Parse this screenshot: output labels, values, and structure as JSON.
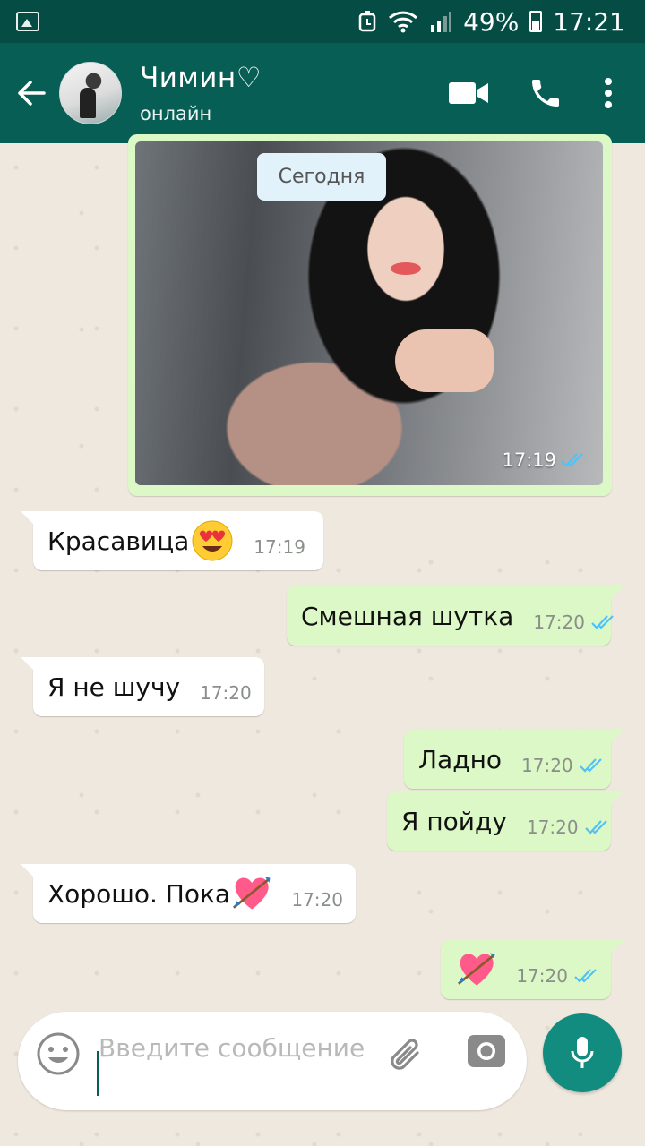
{
  "status_bar": {
    "battery": "49%",
    "time": "17:21"
  },
  "header": {
    "contact_name": "Чимин♡",
    "contact_status": "онлайн"
  },
  "chat": {
    "date_chip": "Сегодня",
    "image_message": {
      "time": "17:19"
    },
    "messages": [
      {
        "direction": "in",
        "text": "Красавица",
        "emoji": "heart-eyes",
        "time": "17:19"
      },
      {
        "direction": "out",
        "text": "Смешная шутка",
        "time": "17:20"
      },
      {
        "direction": "in",
        "text": "Я не шучу",
        "time": "17:20"
      },
      {
        "direction": "out",
        "text": "Ладно",
        "time": "17:20"
      },
      {
        "direction": "out",
        "text": "Я пойду",
        "time": "17:20"
      },
      {
        "direction": "in",
        "text": "Хорошо. Пока",
        "emoji": "heart-with-arrow",
        "time": "17:20"
      },
      {
        "direction": "out",
        "text": "",
        "emoji": "heart-with-arrow",
        "time": "17:20"
      }
    ]
  },
  "input": {
    "placeholder": "Введите сообщение"
  },
  "colors": {
    "header": "#075e54",
    "status_bar": "#054d44",
    "outgoing_bubble": "#dcf8c6",
    "incoming_bubble": "#ffffff",
    "read_ticks": "#4fc3f7",
    "mic_button": "#128c7e"
  }
}
